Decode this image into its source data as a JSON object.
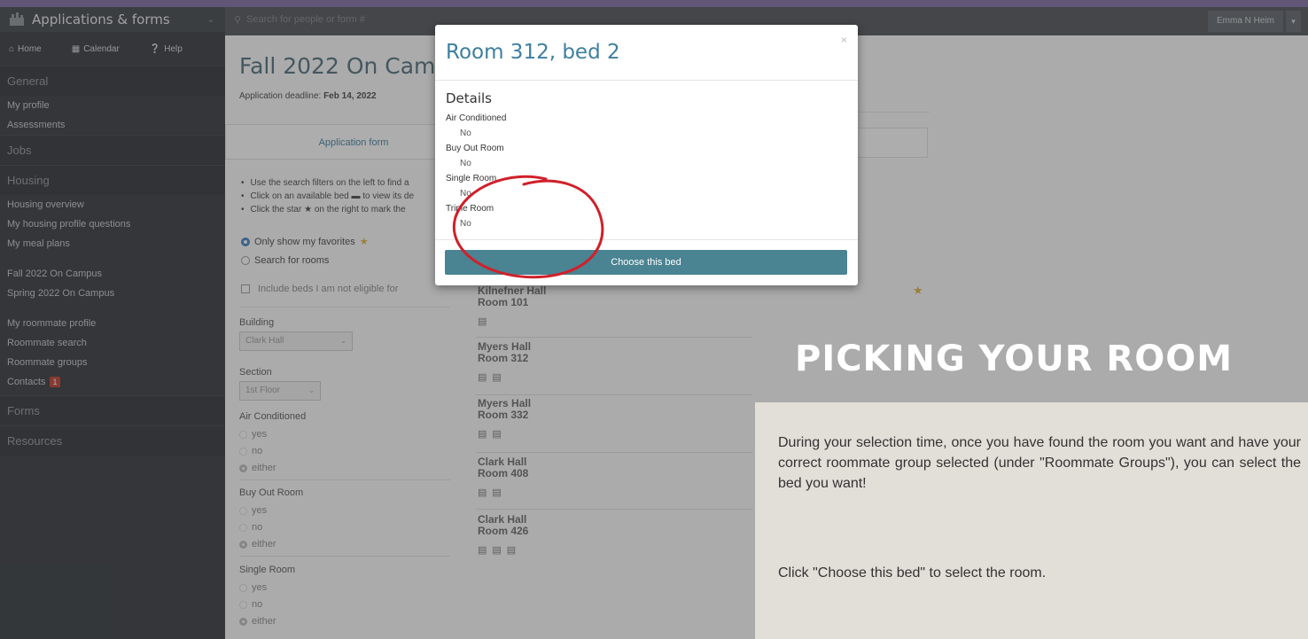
{
  "sidebar": {
    "app_title": "Applications & forms",
    "nav": [
      {
        "icon": "home-icon",
        "label": "Home"
      },
      {
        "icon": "calendar-icon",
        "label": "Calendar"
      },
      {
        "icon": "help-icon",
        "label": "Help"
      }
    ],
    "general_header": "General",
    "my_profile": "My profile",
    "assessments": "Assessments",
    "jobs_header": "Jobs",
    "housing_header": "Housing",
    "housing_overview": "Housing overview",
    "housing_profile_questions": "My housing profile questions",
    "meal_plans": "My meal plans",
    "fall_campus": "Fall 2022 On Campus",
    "spring_campus": "Spring 2022 On Campus",
    "roommate_profile": "My roommate profile",
    "roommate_search": "Roommate search",
    "roommate_groups": "Roommate groups",
    "contacts": "Contacts",
    "contacts_badge": "1",
    "forms_header": "Forms",
    "resources_header": "Resources"
  },
  "topbar": {
    "search_placeholder": "Search for people or form #",
    "user_name": "Emma N Heim"
  },
  "main": {
    "page_title": "Fall 2022 On Cam",
    "deadline_label": "Application deadline:",
    "deadline_value": "Feb 14, 2022",
    "tab_application": "Application form",
    "bullets": [
      "Use the search filters on the left to find a",
      "Click on an available bed ▬ to view its de",
      "Click the star ★ on the right to mark the"
    ],
    "only_favorites": "Only show my favorites",
    "search_rooms": "Search for rooms",
    "include_ineligible": "Include beds I am not eligible for",
    "building_label": "Building",
    "building_value": "Clark Hall",
    "section_label": "Section",
    "section_value": "1st Floor",
    "ac_label": "Air Conditioned",
    "buyout_label": "Buy Out Room",
    "single_label": "Single Room",
    "opt_yes": "yes",
    "opt_no": "no",
    "opt_either": "either"
  },
  "results": [
    {
      "hall": "Kilnefner Hall",
      "room": "Room 101",
      "beds": 1
    },
    {
      "hall": "Myers Hall",
      "room": "Room 312",
      "beds": 2
    },
    {
      "hall": "Myers Hall",
      "room": "Room 332",
      "beds": 2
    },
    {
      "hall": "Clark Hall",
      "room": "Room 408",
      "beds": 2
    },
    {
      "hall": "Clark Hall",
      "room": "Room 426",
      "beds": 3
    }
  ],
  "modal": {
    "title": "Room 312, bed 2",
    "details_header": "Details",
    "fields": [
      {
        "label": "Air Conditioned",
        "value": "No"
      },
      {
        "label": "Buy Out Room",
        "value": "No"
      },
      {
        "label": "Single Room",
        "value": "No"
      },
      {
        "label": "Triple Room",
        "value": "No"
      }
    ],
    "close_symbol": "×",
    "choose_button": "Choose this bed"
  },
  "callout": {
    "title": "PICKING YOUR ROOM",
    "paragraph": "During your selection time, once you have found the room you want and have your correct roommate group selected (under \"Roommate Groups\"), you can select the bed you want!",
    "instruction": "Click \"Choose this bed\" to select the room."
  },
  "colors": {
    "accent_purple": "#7d6a9f",
    "modal_title_blue": "#3d7fa0",
    "button_teal": "#4a8391",
    "annotation_red": "#d0202a",
    "callout_bg": "#e2ded8"
  }
}
